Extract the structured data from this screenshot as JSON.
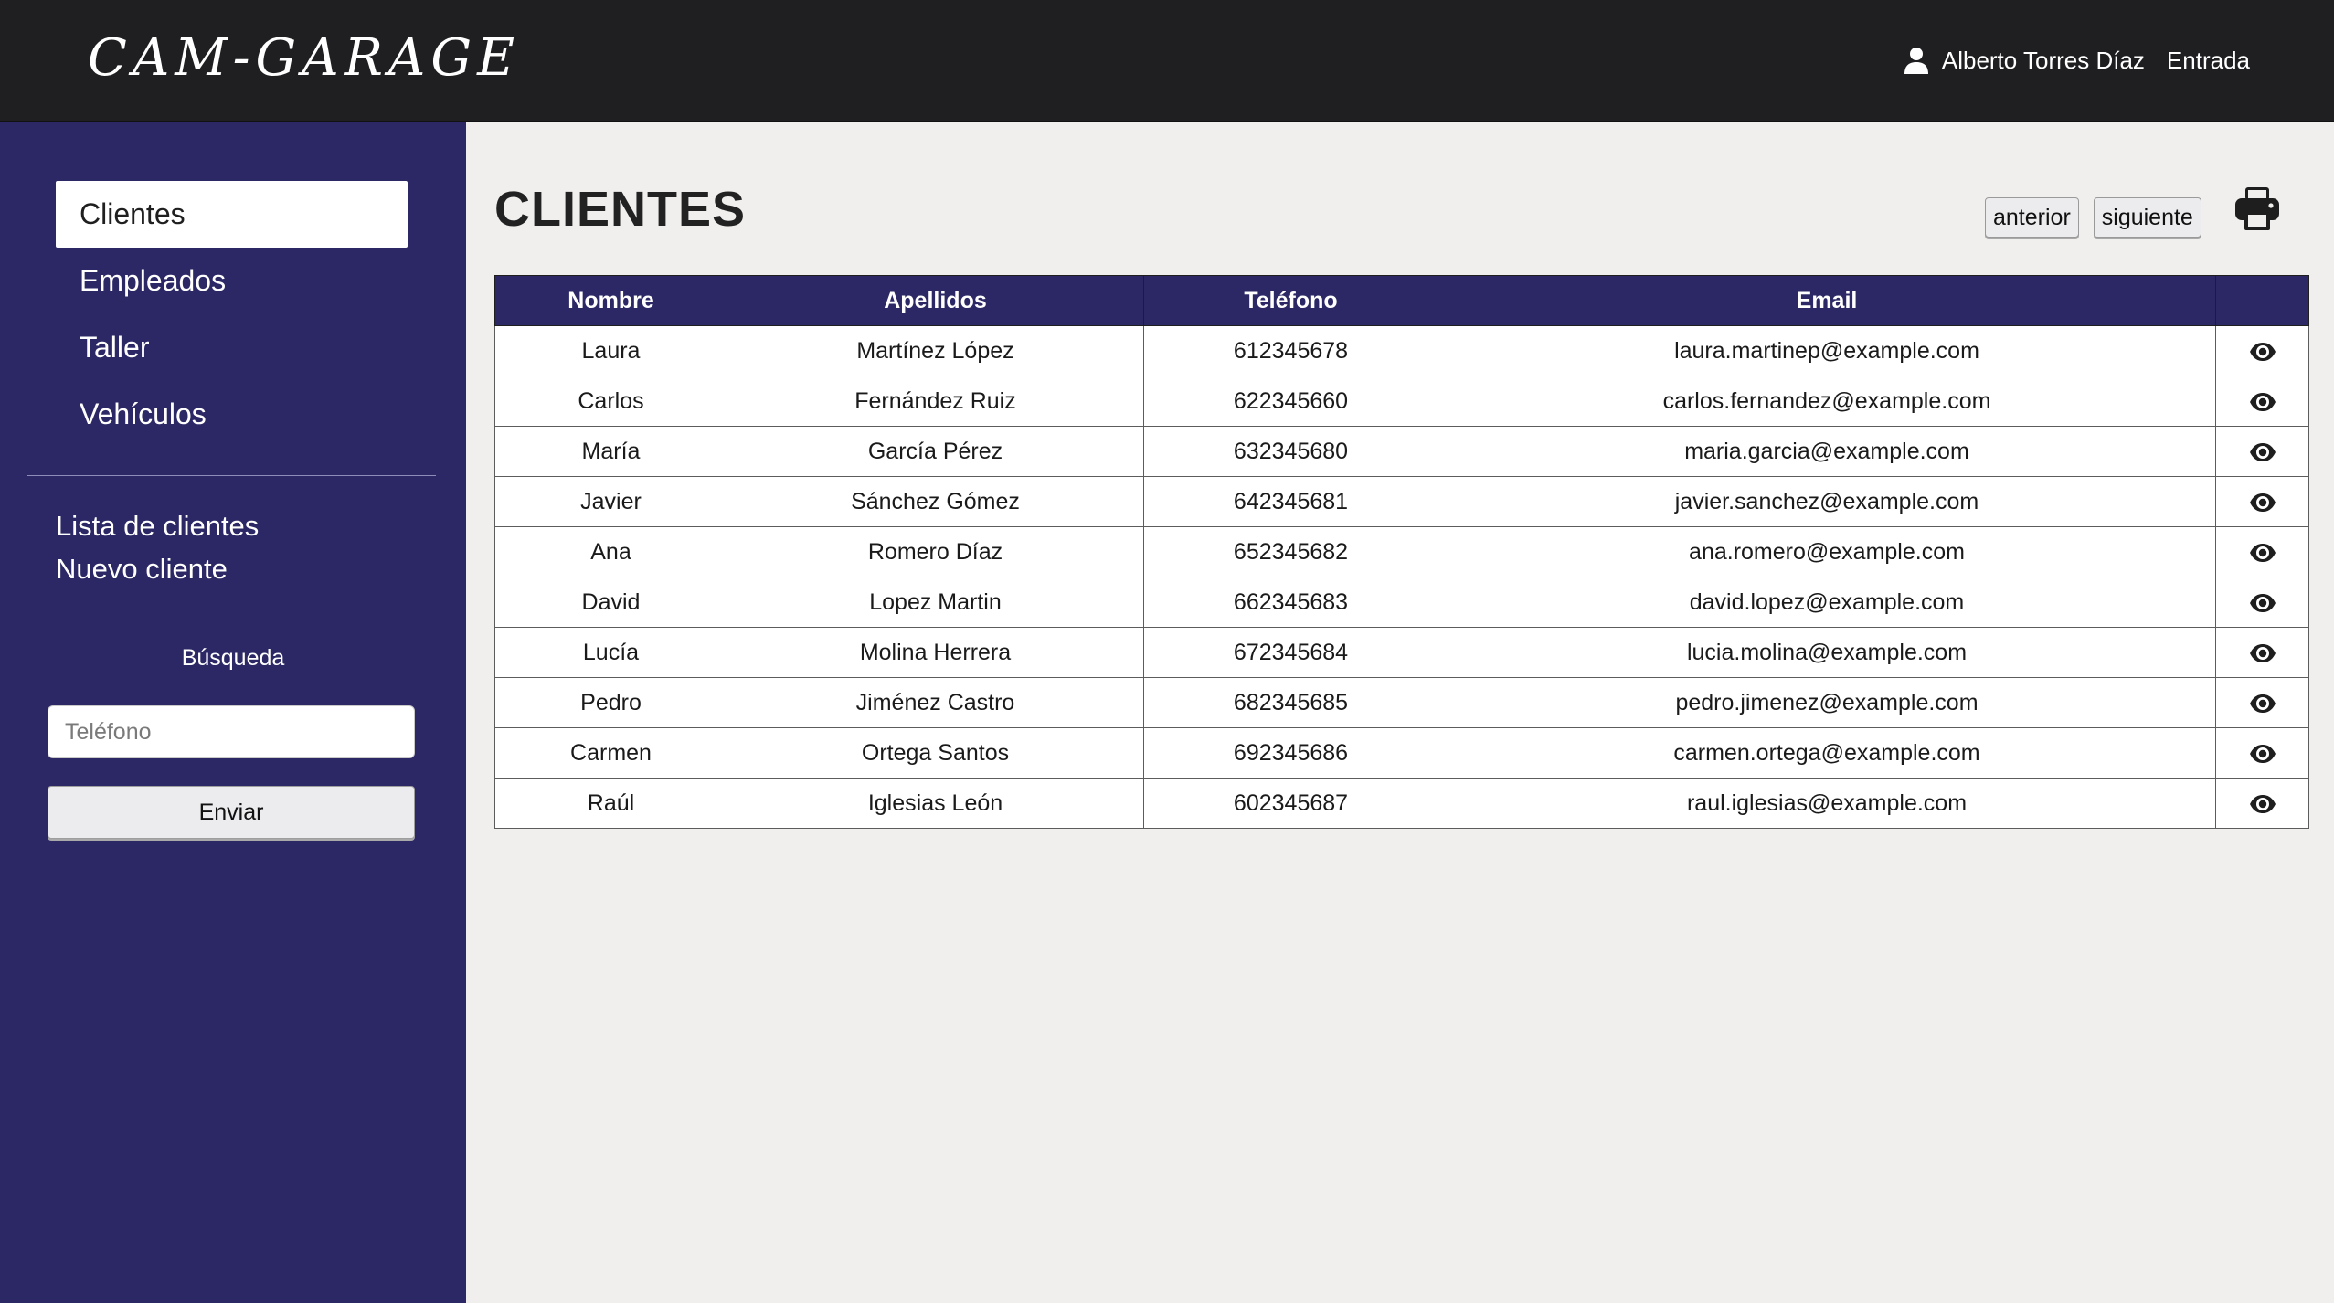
{
  "header": {
    "logo": "CAM-GARAGE",
    "user_name": "Alberto Torres Díaz",
    "login_label": "Entrada",
    "user_icon": "user-icon"
  },
  "sidebar": {
    "nav": [
      {
        "label": "Clientes",
        "active": true
      },
      {
        "label": "Empleados",
        "active": false
      },
      {
        "label": "Taller",
        "active": false
      },
      {
        "label": "Vehículos",
        "active": false
      }
    ],
    "sub_links": [
      {
        "label": "Lista de clientes"
      },
      {
        "label": "Nuevo cliente"
      }
    ],
    "search": {
      "label": "Búsqueda",
      "placeholder": "Teléfono",
      "button_label": "Enviar"
    }
  },
  "main": {
    "title": "CLIENTES",
    "prev_label": "anterior",
    "next_label": "siguiente",
    "print_icon": "printer-icon",
    "table": {
      "headers": [
        "Nombre",
        "Apellidos",
        "Teléfono",
        "Email",
        ""
      ],
      "rows": [
        {
          "nombre": "Laura",
          "apellidos": "Martínez López",
          "telefono": "612345678",
          "email": "laura.martinep@example.com"
        },
        {
          "nombre": "Carlos",
          "apellidos": "Fernández Ruiz",
          "telefono": "622345660",
          "email": "carlos.fernandez@example.com"
        },
        {
          "nombre": "María",
          "apellidos": "García Pérez",
          "telefono": "632345680",
          "email": "maria.garcia@example.com"
        },
        {
          "nombre": "Javier",
          "apellidos": "Sánchez Gómez",
          "telefono": "642345681",
          "email": "javier.sanchez@example.com"
        },
        {
          "nombre": "Ana",
          "apellidos": "Romero Díaz",
          "telefono": "652345682",
          "email": "ana.romero@example.com"
        },
        {
          "nombre": "David",
          "apellidos": "Lopez Martin",
          "telefono": "662345683",
          "email": "david.lopez@example.com"
        },
        {
          "nombre": "Lucía",
          "apellidos": "Molina Herrera",
          "telefono": "672345684",
          "email": "lucia.molina@example.com"
        },
        {
          "nombre": "Pedro",
          "apellidos": "Jiménez Castro",
          "telefono": "682345685",
          "email": "pedro.jimenez@example.com"
        },
        {
          "nombre": "Carmen",
          "apellidos": "Ortega Santos",
          "telefono": "692345686",
          "email": "carmen.ortega@example.com"
        },
        {
          "nombre": "Raúl",
          "apellidos": "Iglesias León",
          "telefono": "602345687",
          "email": "raul.iglesias@example.com"
        }
      ],
      "row_action_icon": "eye-icon"
    }
  },
  "colors": {
    "header_bg": "#1f1f22",
    "sidebar_bg": "#2b2865",
    "table_header_bg": "#2b2865",
    "page_bg": "#f0efee"
  }
}
